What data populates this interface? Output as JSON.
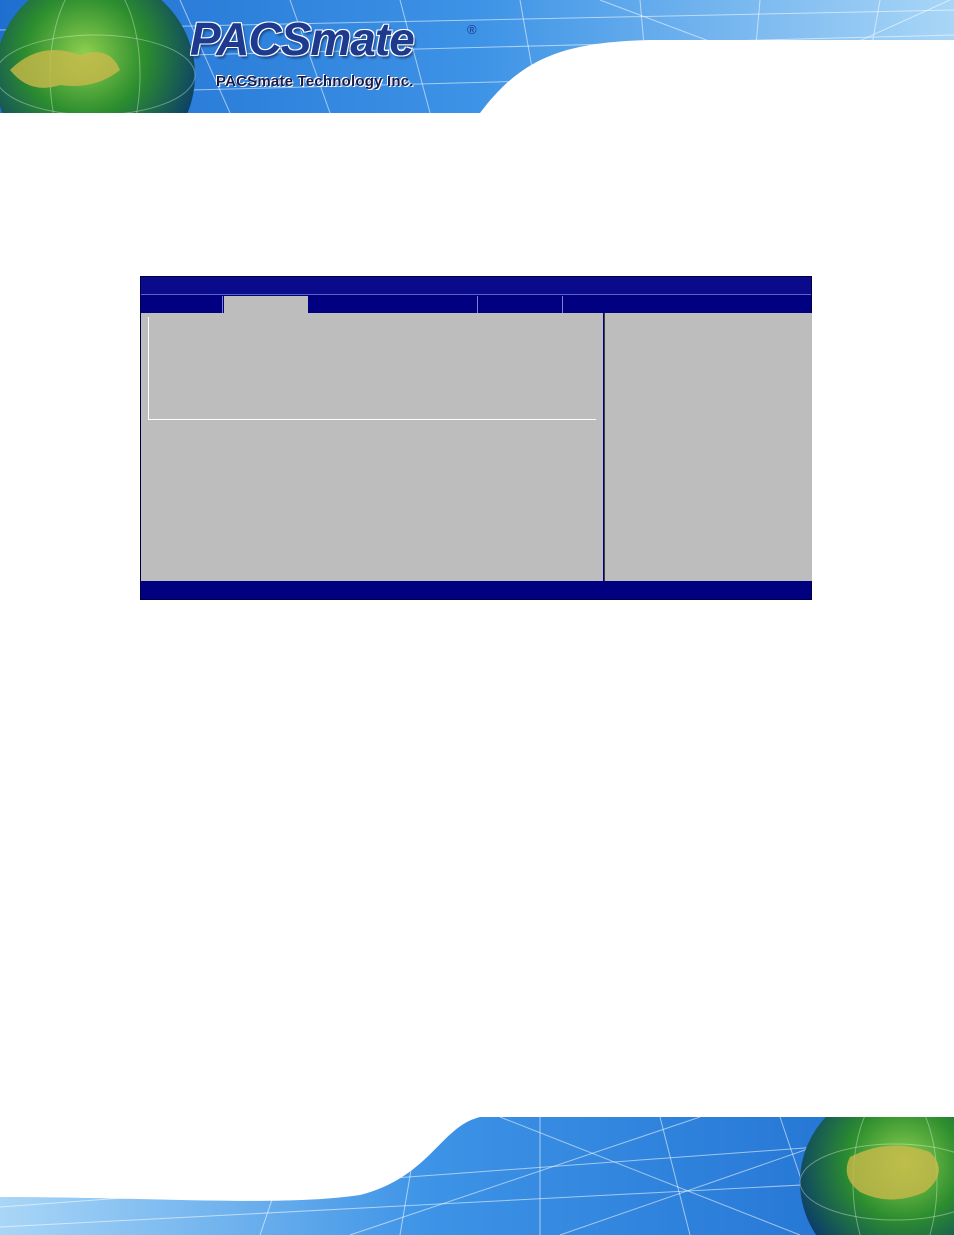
{
  "header": {
    "brand_name": "PACSmate",
    "registered_mark": "®",
    "company_name": "PACSmate Technology Inc.",
    "brand_color": "#1d3a8f"
  },
  "bios_screen": {
    "background_color": "#000080",
    "panel_color": "#bdbdbd"
  }
}
